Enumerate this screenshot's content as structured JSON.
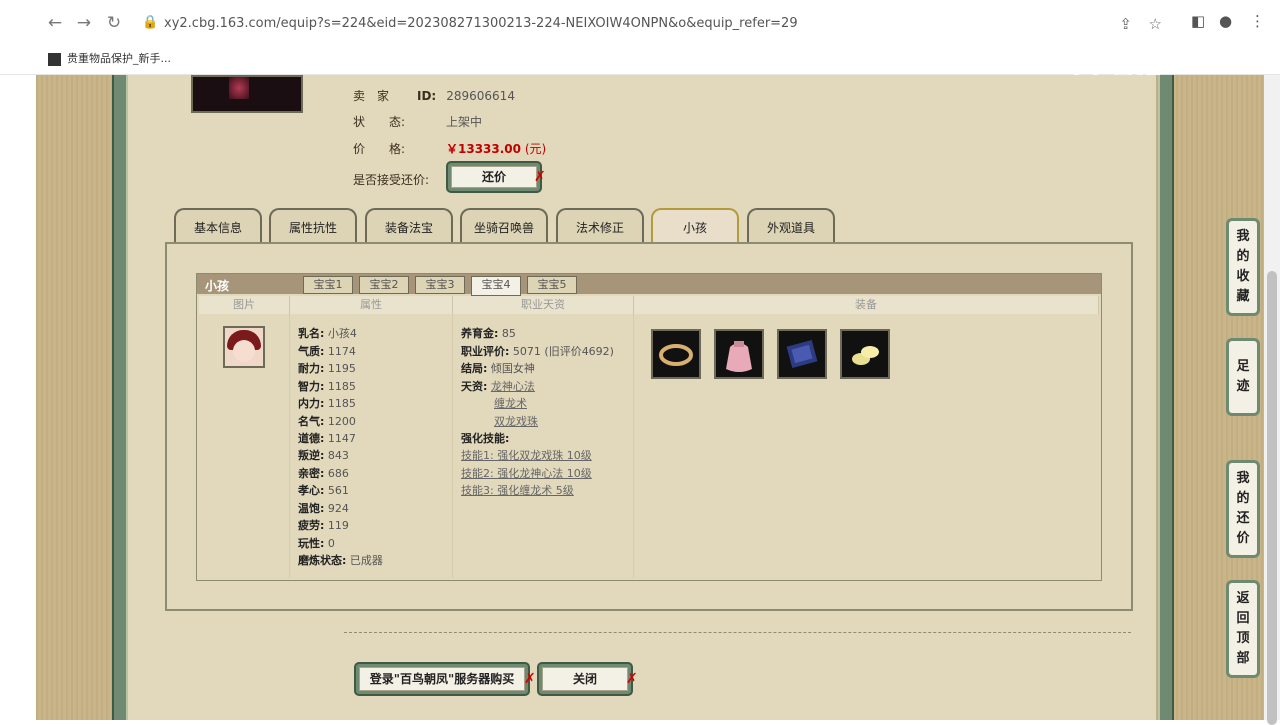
{
  "browser": {
    "url": "xy2.cbg.163.com/equip?s=224&eid=202308271300213-224-NEIXOIW4ONPN&o&equip_refer=29",
    "bookmark": "贵重物品保护_新手..."
  },
  "watermark": "CC直播",
  "seller": {
    "seller_label": "卖　家",
    "id_label": "ID:",
    "id_value": "289606614",
    "status_label": "状　　态:",
    "status_value": "上架中",
    "price_label": "价　　格:",
    "price_value": "￥13333.00",
    "price_unit": "(元)",
    "counter_label": "是否接受还价:",
    "counter_button": "还价"
  },
  "tabs": [
    {
      "label": "基本信息"
    },
    {
      "label": "属性抗性"
    },
    {
      "label": "装备法宝"
    },
    {
      "label": "坐骑召唤兽"
    },
    {
      "label": "法术修正"
    },
    {
      "label": "小孩"
    },
    {
      "label": "外观道具"
    }
  ],
  "child_panel": {
    "title": "小孩",
    "subtabs": [
      "宝宝1",
      "宝宝2",
      "宝宝3",
      "宝宝4",
      "宝宝5"
    ],
    "columns": [
      "图片",
      "属性",
      "职业天资",
      "装备"
    ],
    "attributes": [
      {
        "label": "乳名:",
        "value": "小孩4"
      },
      {
        "label": "气质:",
        "value": "1174"
      },
      {
        "label": "耐力:",
        "value": "1195"
      },
      {
        "label": "智力:",
        "value": "1185"
      },
      {
        "label": "内力:",
        "value": "1185"
      },
      {
        "label": "名气:",
        "value": "1200"
      },
      {
        "label": "道德:",
        "value": "1147"
      },
      {
        "label": "叛逆:",
        "value": "843"
      },
      {
        "label": "亲密:",
        "value": "686"
      },
      {
        "label": "孝心:",
        "value": "561"
      },
      {
        "label": "温饱:",
        "value": "924"
      },
      {
        "label": "疲劳:",
        "value": "119"
      },
      {
        "label": "玩性:",
        "value": "0"
      },
      {
        "label": "磨炼状态:",
        "value": "已成器"
      }
    ],
    "job": {
      "fund_label": "养育金:",
      "fund_value": "85",
      "rating_label": "职业评价:",
      "rating_value": "5071 (旧评价4692)",
      "ending_label": "结局:",
      "ending_value": "倾国女神",
      "talent_label": "天资:",
      "talents": [
        "龙神心法",
        "缠龙术",
        "双龙戏珠"
      ],
      "enhance_label": "强化技能:",
      "skills": [
        "技能1: 强化双龙戏珠 10级",
        "技能2: 强化龙神心法 10级",
        "技能3: 强化缠龙术 5级"
      ]
    }
  },
  "bottom": {
    "login_button": "登录\"百鸟朝凤\"服务器购买",
    "close_button": "关闭"
  },
  "sidebar": {
    "favorites": "我的收藏",
    "history": "足迹",
    "my_offers": "我的还价",
    "back_to_top": "返回顶部"
  }
}
